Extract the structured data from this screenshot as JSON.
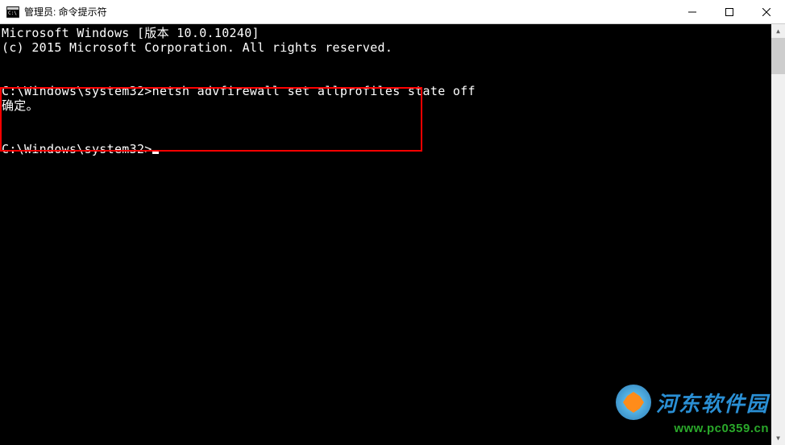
{
  "window": {
    "title": "管理员: 命令提示符"
  },
  "terminal": {
    "line1": "Microsoft Windows [版本 10.0.10240]",
    "line2": "(c) 2015 Microsoft Corporation. All rights reserved.",
    "prompt1": "C:\\Windows\\system32>",
    "command1": "netsh advfirewall set allprofiles state off",
    "result1": "确定。",
    "prompt2": "C:\\Windows\\system32>"
  },
  "watermark": {
    "title": "河东软件园",
    "url": "www.pc0359.cn"
  }
}
